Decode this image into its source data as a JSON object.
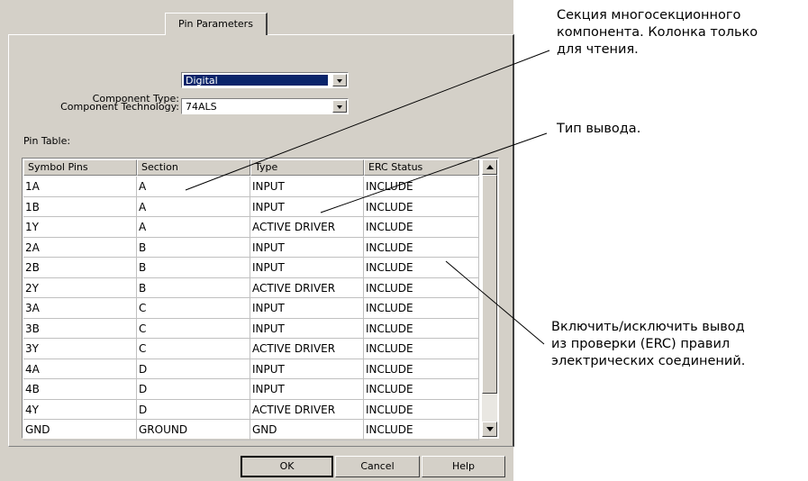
{
  "dialog": {
    "tab_label": "Pin Parameters",
    "component_type_label": "Component Type:",
    "component_type_value": "Digital",
    "component_technology_label": "Component Technology:",
    "component_technology_value": "74ALS",
    "pin_table_label": "Pin Table:",
    "columns": [
      "Symbol Pins",
      "Section",
      "Type",
      "ERC Status"
    ],
    "rows": [
      [
        "1A",
        "A",
        "INPUT",
        "INCLUDE"
      ],
      [
        "1B",
        "A",
        "INPUT",
        "INCLUDE"
      ],
      [
        "1Y",
        "A",
        "ACTIVE DRIVER",
        "INCLUDE"
      ],
      [
        "2A",
        "B",
        "INPUT",
        "INCLUDE"
      ],
      [
        "2B",
        "B",
        "INPUT",
        "INCLUDE"
      ],
      [
        "2Y",
        "B",
        "ACTIVE DRIVER",
        "INCLUDE"
      ],
      [
        "3A",
        "C",
        "INPUT",
        "INCLUDE"
      ],
      [
        "3B",
        "C",
        "INPUT",
        "INCLUDE"
      ],
      [
        "3Y",
        "C",
        "ACTIVE DRIVER",
        "INCLUDE"
      ],
      [
        "4A",
        "D",
        "INPUT",
        "INCLUDE"
      ],
      [
        "4B",
        "D",
        "INPUT",
        "INCLUDE"
      ],
      [
        "4Y",
        "D",
        "ACTIVE DRIVER",
        "INCLUDE"
      ],
      [
        "GND",
        "GROUND",
        "GND",
        "INCLUDE"
      ]
    ],
    "buttons": {
      "ok": "OK",
      "cancel": "Cancel",
      "help": "Help"
    },
    "colors": {
      "dialog_bg": "#d4d0c8",
      "selection": "#0a246a"
    }
  },
  "annotations": {
    "section_note": [
      "Секция многосекционного",
      "компонента. Колонка только",
      "для чтения."
    ],
    "type_note": [
      "Тип вывода."
    ],
    "erc_note": [
      "Включить/исключить вывод",
      "из проверки (ERC) правил",
      "электрических соединений."
    ]
  }
}
